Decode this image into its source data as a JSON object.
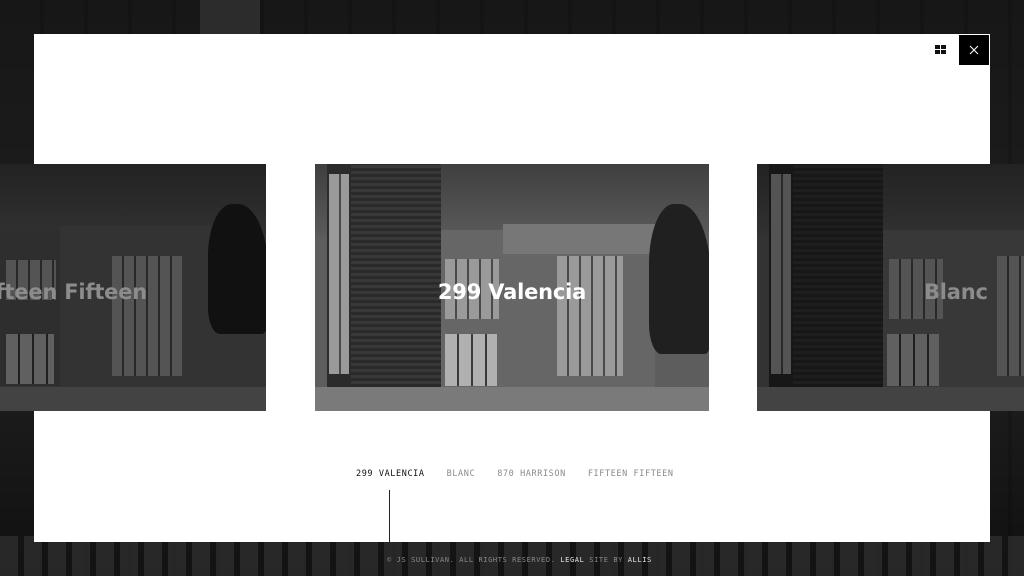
{
  "carousel": {
    "slides": [
      {
        "title": "Fifteen Fifteen",
        "position": "previous"
      },
      {
        "title": "299 Valencia",
        "position": "current"
      },
      {
        "title": "Blanc",
        "position": "next"
      }
    ]
  },
  "nav": {
    "items": [
      "299 VALENCIA",
      "BLANC",
      "870 HARRISON",
      "FIFTEEN FIFTEEN"
    ],
    "active_index": 0
  },
  "footer": {
    "copyright": "© JS SULLIVAN. ALL RIGHTS RESERVED.",
    "legal_label": "LEGAL",
    "site_by_label": "SITE BY",
    "agency_label": "ALLIS"
  },
  "controls": {
    "grid_icon": "grid-icon",
    "close_icon": "close-icon"
  },
  "colors": {
    "modal_bg": "#ffffff",
    "backdrop": "#1b1b1b",
    "close_bg": "#000000",
    "active_nav": "#111111",
    "inactive_nav": "#8a8a8a"
  }
}
